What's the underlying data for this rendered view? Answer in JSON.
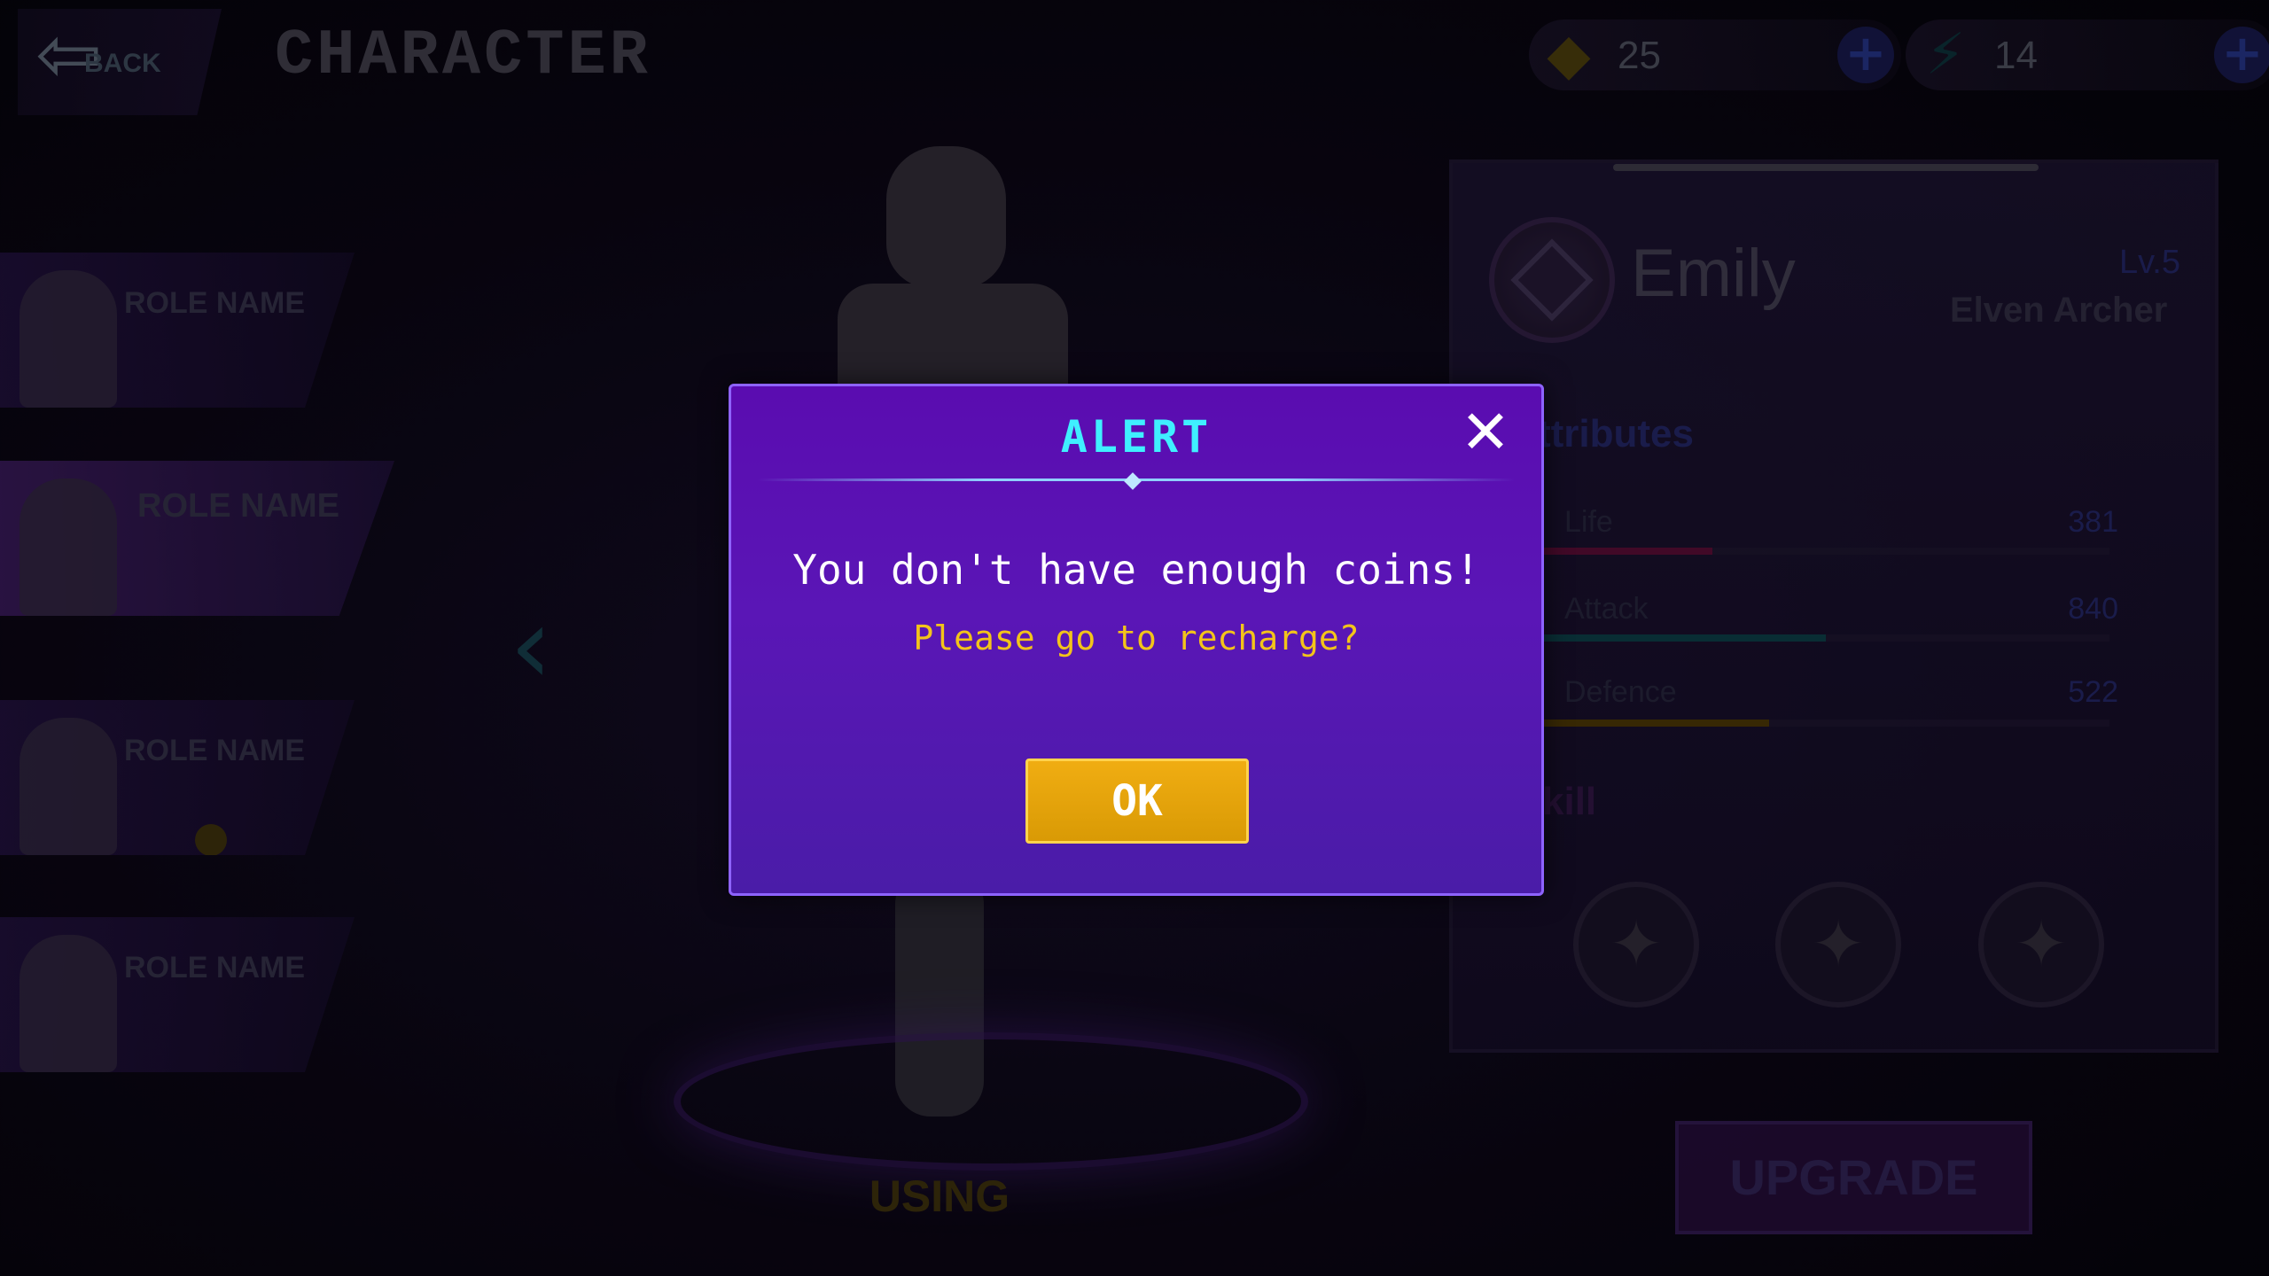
{
  "header": {
    "back_label": "BACK",
    "title": "CHARACTER",
    "gems": {
      "icon": "diamond-icon",
      "value": "25"
    },
    "energy": {
      "icon": "lightning-icon",
      "value": "14"
    }
  },
  "roster": [
    {
      "name": "ROLE NAME"
    },
    {
      "name": "ROLE NAME"
    },
    {
      "name": "ROLE NAME"
    },
    {
      "name": "ROLE NAME"
    }
  ],
  "using_label": "USING",
  "character_panel": {
    "name": "Emily",
    "level": "Lv.5",
    "class": "Elven Archer",
    "section": "ttributes",
    "stats": [
      {
        "label": "Life",
        "value": "381",
        "fill": 0.3,
        "color": "#6a1040"
      },
      {
        "label": "Attack",
        "value": "840",
        "fill": 0.5,
        "color": "#0f4a55"
      },
      {
        "label": "Defence",
        "value": "522",
        "fill": 0.4,
        "color": "#5a4208"
      }
    ],
    "skill_label": "kill",
    "upgrade_label": "UPGRADE"
  },
  "alert": {
    "title": "ALERT",
    "close": "✕",
    "message": "You don't have enough coins!",
    "sub_message": "Please go to recharge?",
    "ok_label": "OK"
  },
  "colors": {
    "alert_title": "#3ff0ff",
    "alert_sub": "#f3c41a",
    "ok_button": "#e8a60b",
    "alert_bg": "#5a0cb0"
  }
}
